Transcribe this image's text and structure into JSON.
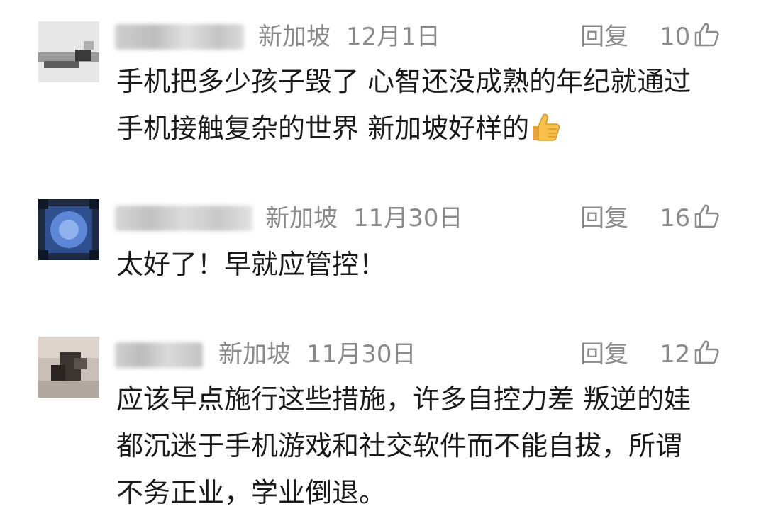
{
  "comments": [
    {
      "location": "新加坡",
      "date": "12月1日",
      "reply_label": "回复",
      "likes": "10",
      "text_lines": [
        "手机把多少孩子毁了 心智还没成熟的年纪就通过",
        "手机接触复杂的世界 新加坡好样的"
      ],
      "emoji": "thumbs-up"
    },
    {
      "location": "新加坡",
      "date": "11月30日",
      "reply_label": "回复",
      "likes": "16",
      "text_lines": [
        "太好了！早就应管控！"
      ]
    },
    {
      "location": "新加坡",
      "date": "11月30日",
      "reply_label": "回复",
      "likes": "12",
      "text_lines": [
        "应该早点施行这些措施，许多自控力差 叛逆的娃",
        "都沉迷于手机游戏和社交软件而不能自拔，所谓",
        "不务正业，学业倒退。"
      ]
    }
  ],
  "colors": {
    "meta": "#8a8a8a",
    "text": "#1a1a1a",
    "background": "#ffffff"
  }
}
